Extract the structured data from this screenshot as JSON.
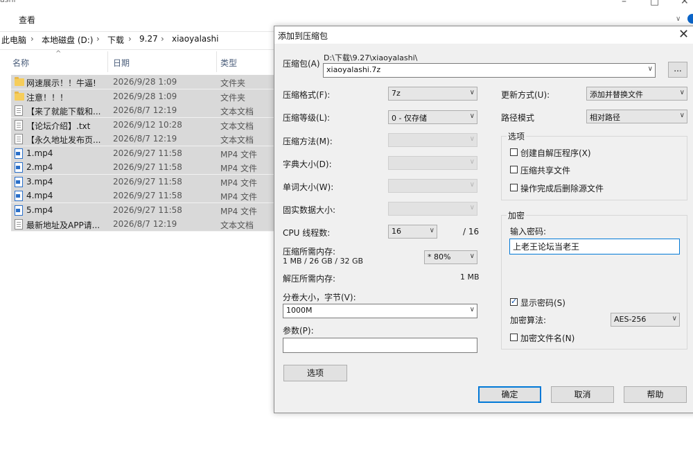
{
  "explorer": {
    "title_fragment": "ashi",
    "menu_view": "查看",
    "breadcrumbs": [
      "此电脑",
      "本地磁盘 (D:)",
      "下载",
      "9.27",
      "xiaoyalashi"
    ],
    "columns": {
      "name": "名称",
      "date": "日期",
      "type": "类型"
    },
    "files": [
      {
        "name": "网速展示！！牛逼!",
        "date": "2026/9/28 1:09",
        "type": "文件夹",
        "icon": "folder-icon"
      },
      {
        "name": "注意！！！",
        "date": "2026/9/28 1:09",
        "type": "文件夹",
        "icon": "folder-icon"
      },
      {
        "name": "【来了就能下载和...",
        "date": "2026/8/7 12:19",
        "type": "文本文档",
        "icon": "text-file-icon"
      },
      {
        "name": "【论坛介绍】.txt",
        "date": "2026/9/12 10:28",
        "type": "文本文档",
        "icon": "text-file-icon"
      },
      {
        "name": "【永久地址发布页...",
        "date": "2026/8/7 12:19",
        "type": "文本文档",
        "icon": "text-file-icon"
      },
      {
        "name": "1.mp4",
        "date": "2026/9/27 11:58",
        "type": "MP4 文件",
        "icon": "video-file-icon"
      },
      {
        "name": "2.mp4",
        "date": "2026/9/27 11:58",
        "type": "MP4 文件",
        "icon": "video-file-icon"
      },
      {
        "name": "3.mp4",
        "date": "2026/9/27 11:58",
        "type": "MP4 文件",
        "icon": "video-file-icon"
      },
      {
        "name": "4.mp4",
        "date": "2026/9/27 11:58",
        "type": "MP4 文件",
        "icon": "video-file-icon"
      },
      {
        "name": "5.mp4",
        "date": "2026/9/27 11:58",
        "type": "MP4 文件",
        "icon": "video-file-icon"
      },
      {
        "name": "最新地址及APP请...",
        "date": "2026/8/7 12:19",
        "type": "文本文档",
        "icon": "text-file-icon"
      }
    ]
  },
  "dialog": {
    "title": "添加到压缩包",
    "archive_label": "压缩包(A)",
    "archive_path": "D:\\下载\\9.27\\xiaoyalashi\\",
    "archive_name": "xiaoyalashi.7z",
    "browse_label": "...",
    "format_label": "压缩格式(F):",
    "format_value": "7z",
    "level_label": "压缩等级(L):",
    "level_value": "0 - 仅存储",
    "method_label": "压缩方法(M):",
    "dict_label": "字典大小(D):",
    "word_label": "单词大小(W):",
    "solid_label": "固实数据大小:",
    "cpu_label": "CPU 线程数:",
    "cpu_value": "16",
    "cpu_total": "/ 16",
    "mem_comp_label": "压缩所需内存:",
    "mem_comp_info": "1 MB / 26 GB / 32 GB",
    "mem_percent": "* 80%",
    "mem_decomp_label": "解压所需内存:",
    "mem_decomp_value": "1 MB",
    "volume_label": "分卷大小，字节(V):",
    "volume_value": "1000M",
    "params_label": "参数(P):",
    "params_value": "",
    "options_button": "选项",
    "update_label": "更新方式(U):",
    "update_value": "添加并替换文件",
    "path_label": "路径模式",
    "path_value": "相对路径",
    "options_group": "选项",
    "opt_sfx": "创建自解压程序(X)",
    "opt_shared": "压缩共享文件",
    "opt_delete": "操作完成后删除源文件",
    "enc_group": "加密",
    "password_label": "输入密码:",
    "password_value": "上老王论坛当老王",
    "show_password": "显示密码(S)",
    "enc_method_label": "加密算法:",
    "enc_method_value": "AES-256",
    "enc_names": "加密文件名(N)",
    "ok": "确定",
    "cancel": "取消",
    "help": "帮助"
  }
}
